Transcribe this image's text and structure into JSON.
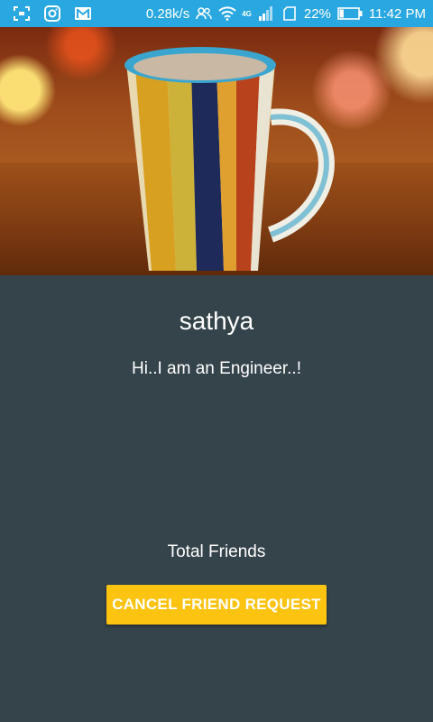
{
  "status_bar": {
    "left_icons": [
      "screenshot-icon",
      "instagram-icon",
      "gmail-icon"
    ],
    "network_speed": "0.28k/s",
    "network_type": "4G",
    "battery_percent": "22%",
    "battery_level": 0.22,
    "time": "11:42 PM",
    "background_color": "#29a7e1"
  },
  "profile": {
    "name": "sathya",
    "status": "Hi..I am an Engineer..!",
    "friends_label": "Total Friends"
  },
  "actions": {
    "cancel_request_label": "CANCEL FRIEND REQUEST",
    "button_color": "#fdc311"
  },
  "theme": {
    "background": "#35434b"
  }
}
